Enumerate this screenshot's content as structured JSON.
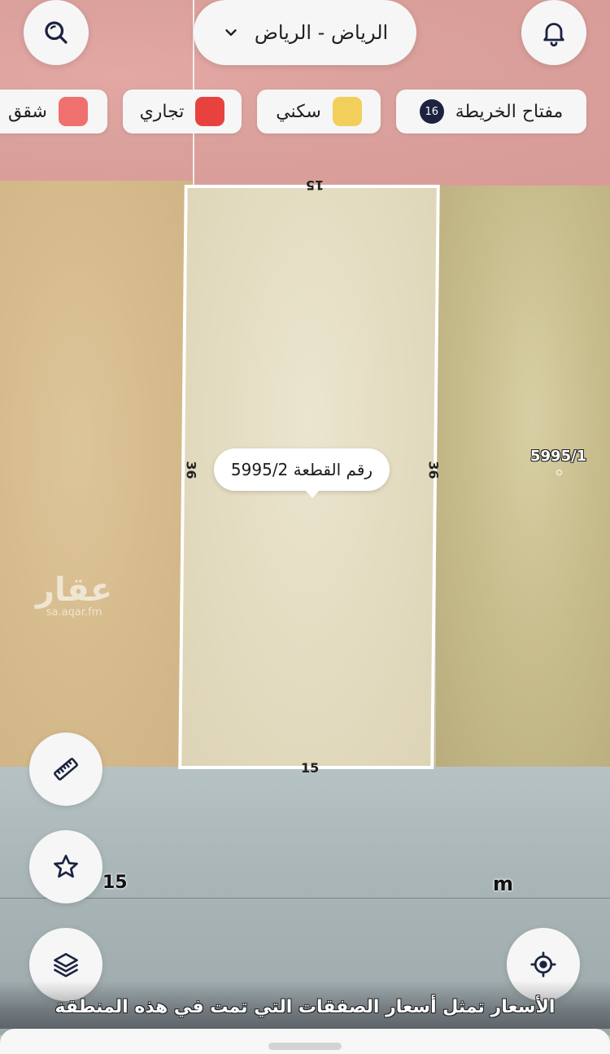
{
  "header": {
    "city_label": "الرياض - الرياض",
    "search_icon": "search-icon",
    "bell_icon": "bell-icon",
    "chevron_icon": "chevron-down-icon"
  },
  "legend": {
    "key_label": "مفتاح الخريطة",
    "key_count": "16",
    "items": [
      {
        "label": "سكني",
        "color": "#f2cf5b"
      },
      {
        "label": "تجاري",
        "color": "#e8423f"
      },
      {
        "label": "شقق",
        "color": "#f07070"
      }
    ]
  },
  "plot": {
    "label": "رقم القطعة 5995/2",
    "dimension_top": "15",
    "dimension_bottom": "15",
    "dimension_left": "36",
    "dimension_right": "36"
  },
  "neighbor": {
    "label": "5995/1"
  },
  "watermark": {
    "arabic": "عقار",
    "url": "sa.aqar.fm"
  },
  "street": {
    "number": "15",
    "unit": "m"
  },
  "controls": {
    "ruler_icon": "ruler-icon",
    "star_icon": "star-icon",
    "layers_icon": "layers-icon",
    "locate_icon": "locate-icon"
  },
  "caption": "الأسعار تمثل أسعار الصفقات التي تمت في هذه المنطقة"
}
